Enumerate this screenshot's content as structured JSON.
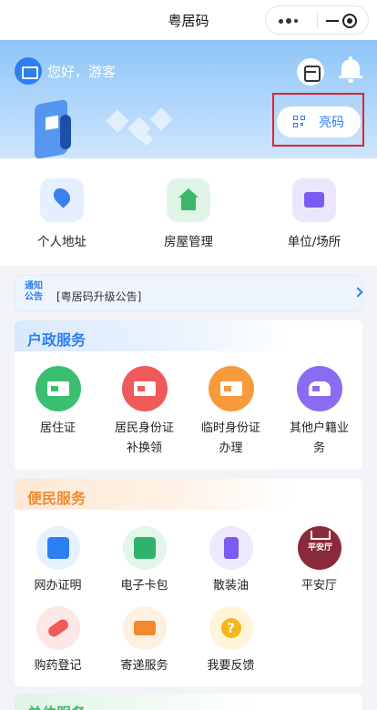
{
  "app": {
    "title": "粤居码"
  },
  "banner": {
    "greeting": "您好，游客",
    "show_code_label": "亮码"
  },
  "quick_actions": [
    {
      "label": "个人地址",
      "icon": "location-pin-icon"
    },
    {
      "label": "房屋管理",
      "icon": "house-icon"
    },
    {
      "label": "单位/场所",
      "icon": "briefcase-icon"
    }
  ],
  "notice": {
    "tag_line1": "通知",
    "tag_line2": "公告",
    "text": "[粤居码升级公告]"
  },
  "household_services": {
    "title": "户政服务",
    "items": [
      {
        "label_line1": "居住证",
        "label_line2": "",
        "color": "#3bbf6e"
      },
      {
        "label_line1": "居民身份证",
        "label_line2": "补换领",
        "color": "#ef5a5a"
      },
      {
        "label_line1": "临时身份证",
        "label_line2": "办理",
        "color": "#f69a3c"
      },
      {
        "label_line1": "其他户籍业",
        "label_line2": "务",
        "color": "#8a6cf2"
      }
    ]
  },
  "convenience_services": {
    "title": "便民服务",
    "items": [
      {
        "label": "网办证明",
        "icon": "certificate-icon"
      },
      {
        "label": "电子卡包",
        "icon": "wallet-icon"
      },
      {
        "label": "散装油",
        "icon": "oil-bottle-icon"
      },
      {
        "label": "平安厅",
        "icon": "ping-an-ting-logo",
        "logo_text": "平安厅"
      },
      {
        "label": "购药登记",
        "icon": "pill-icon"
      },
      {
        "label": "寄递服务",
        "icon": "delivery-truck-icon"
      },
      {
        "label": "我要反馈",
        "icon": "question-icon",
        "symbol": "?"
      }
    ]
  },
  "third_section": {
    "title": "单位服务"
  },
  "colors": {
    "accent_blue": "#2d7ff0",
    "accent_orange": "#f18a2c",
    "highlight_red": "#e0242a"
  }
}
